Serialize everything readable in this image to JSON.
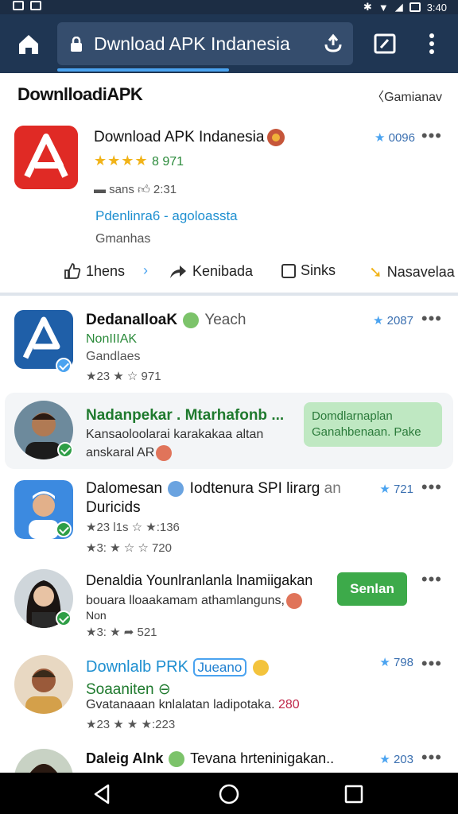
{
  "status_bar": {
    "time": "3:40"
  },
  "browser": {
    "url_text": "Dwnload APK Indanesia",
    "icons": {
      "home": "home-icon",
      "lock": "lock-icon",
      "share": "share-icon",
      "tabs": "tabs-icon",
      "menu": "more-vert-icon"
    }
  },
  "header": {
    "title": "DownlloadiAPK",
    "link": "Gamianav"
  },
  "featured": {
    "title": "Download APK Indanesia",
    "rating_stars": "★★★★",
    "rating_text": "8 971",
    "meta_left": "sans",
    "meta_value": "2:31",
    "likes": "0096",
    "link": "Pdenlinra6 - agoloassta",
    "sub": "Gmanhas",
    "actions": [
      {
        "label": "1hens",
        "icon": "thumbs-up-icon"
      },
      {
        "label": "Kenibada",
        "icon": "share-arrow-icon"
      },
      {
        "label": "Sinks",
        "icon": "checkbox-icon"
      },
      {
        "label": "Nasavelaa",
        "icon": "tag-icon"
      }
    ]
  },
  "items": [
    {
      "title": "DedanaIloaK",
      "title_suffix": "Yeach",
      "line1": "NonIIIAK",
      "line2": "Gandlaes",
      "meta": "★23 ★ ☆ 971",
      "likes": "2087"
    },
    {
      "title": "Nadanpekar . Mtarhafonb ...",
      "line1": "Kansaoloolarai karakakaa altan",
      "line2": "anskaral AR",
      "chip": "Domdlarnaplan Ganahbenaan. Pake"
    },
    {
      "title": "Dalomesan",
      "title_suffix": "Iodtenura SPI lirarg",
      "title_tail": "an",
      "line1": "Duricids",
      "meta1": "★23 l1s ☆ ★:136",
      "meta2": "★3: ★ ☆ ☆ 720",
      "likes": "721"
    },
    {
      "title": "Denaldia Younlranlanla lnamiigakan",
      "line1": "bouara lloaakamam athamlanguns,",
      "line2": "Non",
      "meta": "★3: ★ ➦ 521",
      "cta": "Senlan"
    },
    {
      "title": "Downlalb PRK",
      "tag": "Jueano",
      "line1": "Soaaniten",
      "line2_a": "Gvatanaaan knlalatan ladipotaka.",
      "line2_b": "280",
      "meta": "★23 ★ ★ ★:223",
      "likes": "798"
    },
    {
      "title": "Daleig Alnk",
      "title_suffix": "Tevana hrteninigakan..",
      "likes": "203"
    }
  ],
  "colors": {
    "toolbar": "#1f3653",
    "accent": "#4aa3f0",
    "green": "#3daa4a",
    "red_icon": "#e02a25"
  }
}
